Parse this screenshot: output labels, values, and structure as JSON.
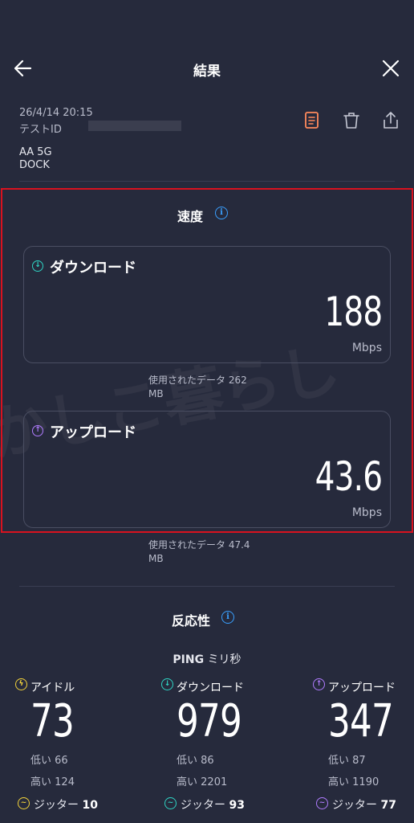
{
  "header": {
    "title": "結果"
  },
  "meta": {
    "datetime": "26/4/14 20:15",
    "test_id_label": "テストID",
    "server_line1": "AA 5G",
    "server_line2": "DOCK"
  },
  "speed": {
    "title": "速度",
    "download": {
      "label": "ダウンロード",
      "value": "188",
      "unit": "Mbps",
      "data_used": "使用されたデータ 262",
      "data_used_unit": "MB"
    },
    "upload": {
      "label": "アップロード",
      "value": "43.6",
      "unit": "Mbps",
      "data_used": "使用されたデータ 47.4",
      "data_used_unit": "MB"
    }
  },
  "responsiveness": {
    "title": "反応性",
    "ping_label": "PING",
    "ping_unit": "ミリ秒",
    "idle": {
      "label": "アイドル",
      "value": "73",
      "low_label": "低い",
      "low": "66",
      "high_label": "高い",
      "high": "124",
      "jitter_label": "ジッター",
      "jitter": "10"
    },
    "download": {
      "label": "ダウンロード",
      "value": "979",
      "low_label": "低い",
      "low": "86",
      "high_label": "高い",
      "high": "2201",
      "jitter_label": "ジッター",
      "jitter": "93"
    },
    "upload": {
      "label": "アップロード",
      "value": "347",
      "low_label": "低い",
      "low": "87",
      "high_label": "高い",
      "high": "1190",
      "jitter_label": "ジッター",
      "jitter": "77"
    }
  },
  "watermark": "かしこ暮らし",
  "colors": {
    "background": "#262a3c",
    "download_accent": "#2fd3c3",
    "upload_accent": "#b07cff",
    "idle_accent": "#f2d23a",
    "info_accent": "#3aa0ff",
    "report_accent": "#ff8a5c",
    "highlight": "#d9121f"
  },
  "icons": [
    "back-arrow-icon",
    "close-icon",
    "report-icon",
    "trash-icon",
    "share-icon",
    "info-icon",
    "download-arrow-icon",
    "upload-arrow-icon",
    "idle-icon",
    "jitter-icon"
  ]
}
